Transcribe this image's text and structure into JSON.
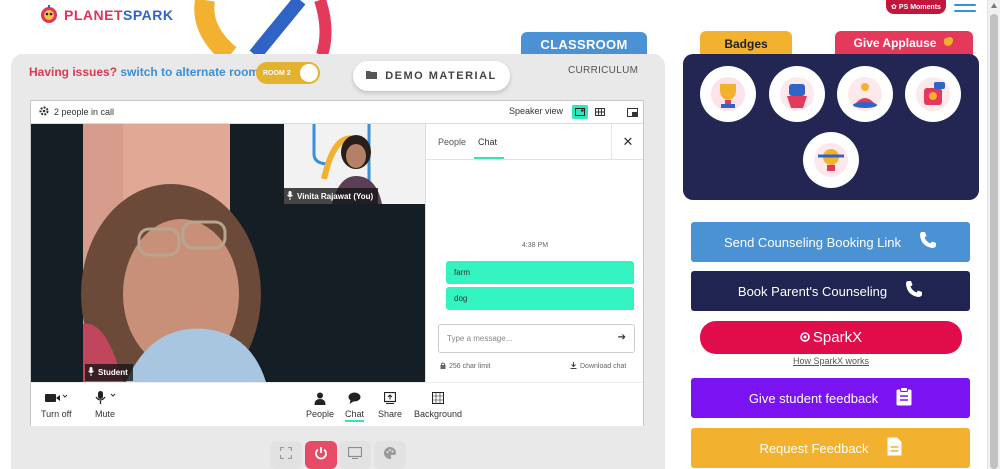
{
  "header": {
    "logo_text_planet": "PLANET",
    "logo_text_spark": "SPARK",
    "ps_moments": "PS Moments"
  },
  "stage": {
    "classroom_tab": "CLASSROOM",
    "issues_text": "Having issues?",
    "switch_link": "switch to alternate room",
    "room_toggle": "ROOM 2",
    "demo_material": "DEMO MATERIAL",
    "curriculum": "CURRICULUM"
  },
  "meeting": {
    "people_count": "2 people in call",
    "speaker_view": "Speaker view",
    "student_name": "Student",
    "teacher_name": "Vinita Rajawat (You)",
    "chat": {
      "tab_people": "People",
      "tab_chat": "Chat",
      "close": "✕",
      "time": "4:38 PM",
      "messages": [
        "farm",
        "dog"
      ],
      "input_placeholder": "Type a message...",
      "char_limit": "256 char limit",
      "download": "Download chat"
    },
    "controls": {
      "video": "Turn off",
      "mute": "Mute",
      "people": "People",
      "chat": "Chat",
      "share": "Share",
      "background": "Background"
    }
  },
  "right_panel": {
    "badges_tab": "Badges",
    "applause_tab": "Give Applause",
    "buttons": {
      "counseling_link": "Send Counseling Booking Link",
      "parent_counseling": "Book Parent's Counseling",
      "sparkx": "SparkX",
      "how_sparkx": "How SparkX works",
      "student_feedback": "Give student feedback",
      "request_feedback": "Request Feedback"
    }
  },
  "colors": {
    "brand_blue": "#4a92d3",
    "brand_navy": "#232553",
    "accent_red": "#e4395a",
    "accent_yellow": "#f2b12f",
    "chat_green": "#33f3c0",
    "purple": "#7b12f2"
  }
}
